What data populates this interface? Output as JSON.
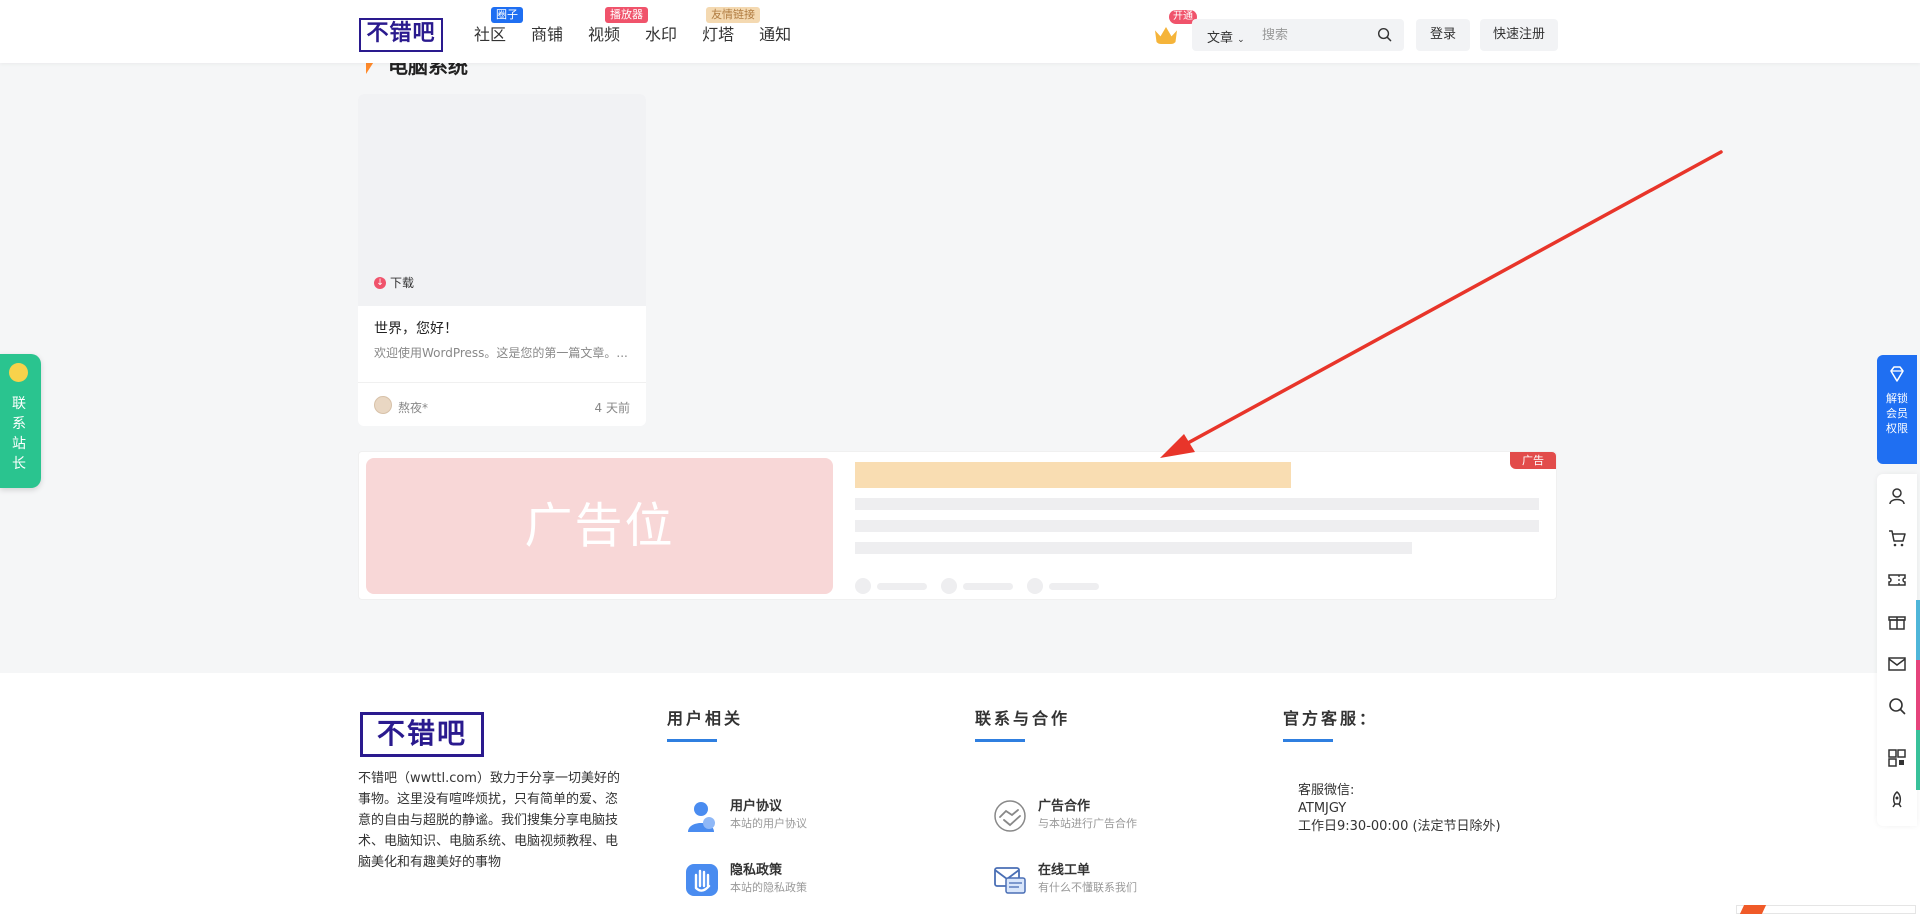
{
  "header": {
    "logo_text": "不错吧",
    "nav": [
      {
        "label": "社区",
        "badge": "圈子",
        "badge_color": "#1f6ff2"
      },
      {
        "label": "商铺",
        "badge": "",
        "badge_color": ""
      },
      {
        "label": "视频",
        "badge": "播放器",
        "badge_color": "#f0536b"
      },
      {
        "label": "水印",
        "badge": "",
        "badge_color": ""
      },
      {
        "label": "灯塔",
        "badge": "友情链接",
        "badge_color": "#f4d9b1"
      },
      {
        "label": "通知",
        "badge": "",
        "badge_color": ""
      }
    ],
    "vip_badge": "开通",
    "search_type": "文章",
    "search_placeholder": "搜索",
    "login": "登录",
    "register": "快速注册"
  },
  "section": {
    "title": "电脑系统"
  },
  "post": {
    "download_label": "下载",
    "title": "世界，您好！",
    "excerpt": "欢迎使用WordPress。这是您的第一篇文章。...",
    "author": "熬夜*",
    "time": "4 天前"
  },
  "ad": {
    "image_text": "广告位",
    "tag": "广告"
  },
  "footer": {
    "logo_text": "不错吧",
    "description": "不错吧（wwttl.com）致力于分享一切美好的事物。这里没有喧哗烦扰，只有简单的爱、恣意的自由与超脱的静谧。我们搜集分享电脑技术、电脑知识、电脑系统、电脑视频教程、电脑美化和有趣美好的事物",
    "col1": {
      "heading": "用户相关",
      "items": [
        {
          "title": "用户协议",
          "subtitle": "本站的用户协议"
        },
        {
          "title": "隐私政策",
          "subtitle": "本站的隐私政策"
        }
      ]
    },
    "col2": {
      "heading": "联系与合作",
      "items": [
        {
          "title": "广告合作",
          "subtitle": "与本站进行广告合作"
        },
        {
          "title": "在线工单",
          "subtitle": "有什么不懂联系我们"
        }
      ]
    },
    "col3": {
      "heading": "官方客服：",
      "lines": [
        "客服微信:",
        "ATMJGY",
        "工作日9:30-00:00 (法定节日除外)"
      ]
    }
  },
  "side": {
    "contact_label": "联系站长",
    "vip_label": "解锁会员权限"
  },
  "colors": {
    "brand": "#2a1a8e",
    "accent_blue": "#1f6ff2",
    "contact_green": "#2ac48f",
    "arrow_red": "#e8352a"
  }
}
